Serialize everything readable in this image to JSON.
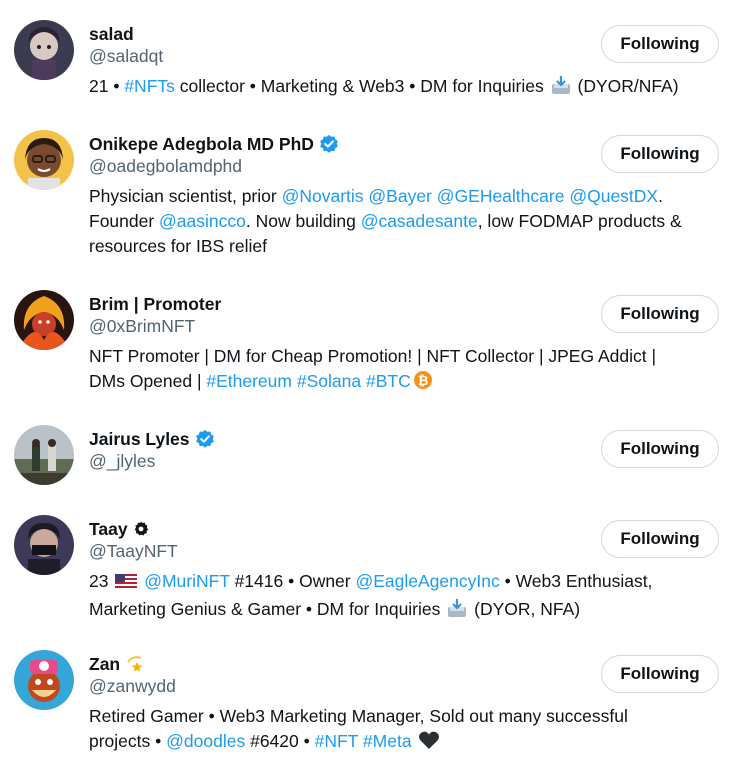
{
  "follow_button_label": "Following",
  "accent_color": "#1d9bf0",
  "users": [
    {
      "name": "salad",
      "handle": "@saladqt",
      "badge": "",
      "bio_line1": [
        "21 • ",
        "#NFTs",
        " collector • Marketing & Web3 • DM for Inquiries ",
        "(DYOR/NFA)"
      ],
      "bio_line2": [],
      "bio_line3": []
    },
    {
      "name": "Onikepe Adegbola MD PhD",
      "handle": "@oadegbolamdphd",
      "badge": "verified-icon",
      "bio_line1": [
        "Physician scientist, prior ",
        "@Novartis",
        " ",
        "@Bayer",
        " ",
        "@GEHealthcare",
        " ",
        "@QuestDX",
        "."
      ],
      "bio_line2": [
        "Founder ",
        "@aasincco",
        ". Now building ",
        "@casadesante",
        ", low FODMAP products &"
      ],
      "bio_line3": [
        "resources for IBS relief"
      ]
    },
    {
      "name": "Brim | Promoter",
      "handle": "@0xBrimNFT",
      "badge": "",
      "bio_line1": [
        "NFT Promoter | DM for Cheap Promotion! | NFT Collector | JPEG Addict |"
      ],
      "bio_line2": [
        "DMs Opened | ",
        "#Ethereum",
        " ",
        "#Solana",
        " ",
        "#BTC"
      ],
      "bio_line3": []
    },
    {
      "name": "Jairus Lyles",
      "handle": "@_jlyles",
      "badge": "verified-icon",
      "bio_line1": [],
      "bio_line2": [],
      "bio_line3": []
    },
    {
      "name": "Taay",
      "handle": "@TaayNFT",
      "badge": "gear-badge-icon",
      "bio_line1": [
        "23 ",
        "@MuriNFT",
        " #1416 • Owner ",
        "@EagleAgencyInc",
        " • Web3 Enthusiast,"
      ],
      "bio_line2": [
        "Marketing Genius & Gamer • DM for Inquiries ",
        "(DYOR, NFA)"
      ],
      "bio_line3": []
    },
    {
      "name": "Zan",
      "handle": "@zanwydd",
      "badge": "dizzy-star-icon",
      "bio_line1": [
        "Retired Gamer • Web3 Marketing Manager, Sold out many successful"
      ],
      "bio_line2": [
        "projects • ",
        "@doodles",
        " #6420 • ",
        "#NFT",
        " ",
        "#Meta"
      ],
      "bio_line3": []
    }
  ]
}
